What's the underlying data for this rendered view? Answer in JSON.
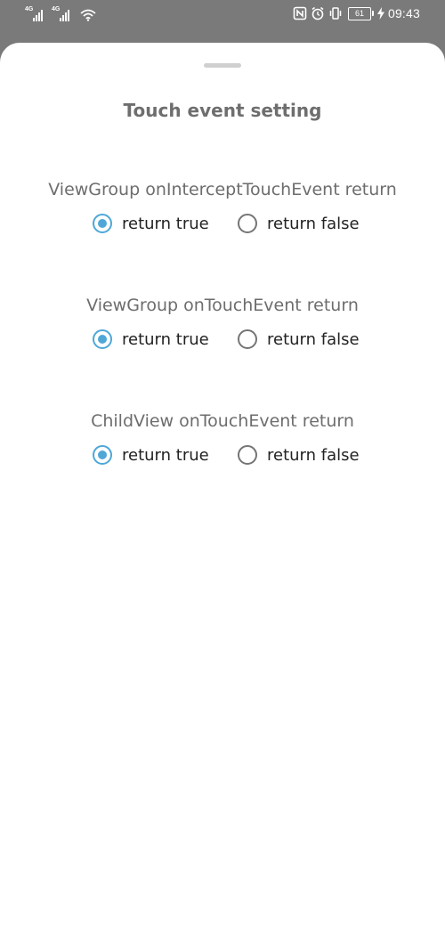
{
  "status_bar": {
    "sim1_tag": "4G",
    "sim2_tag": "4G",
    "battery_level": "61",
    "time": "09:43"
  },
  "sheet": {
    "title": "Touch event setting",
    "groups": [
      {
        "label": "ViewGroup onInterceptTouchEvent return",
        "options": [
          {
            "label": "return true",
            "checked": true
          },
          {
            "label": "return false",
            "checked": false
          }
        ]
      },
      {
        "label": "ViewGroup onTouchEvent return",
        "options": [
          {
            "label": "return true",
            "checked": true
          },
          {
            "label": "return false",
            "checked": false
          }
        ]
      },
      {
        "label": "ChildView onTouchEvent return",
        "options": [
          {
            "label": "return true",
            "checked": true
          },
          {
            "label": "return false",
            "checked": false
          }
        ]
      }
    ]
  },
  "colors": {
    "accent": "#4fa7d8",
    "scrim": "#7a7a7b",
    "sheet_background": "#ffffff"
  }
}
